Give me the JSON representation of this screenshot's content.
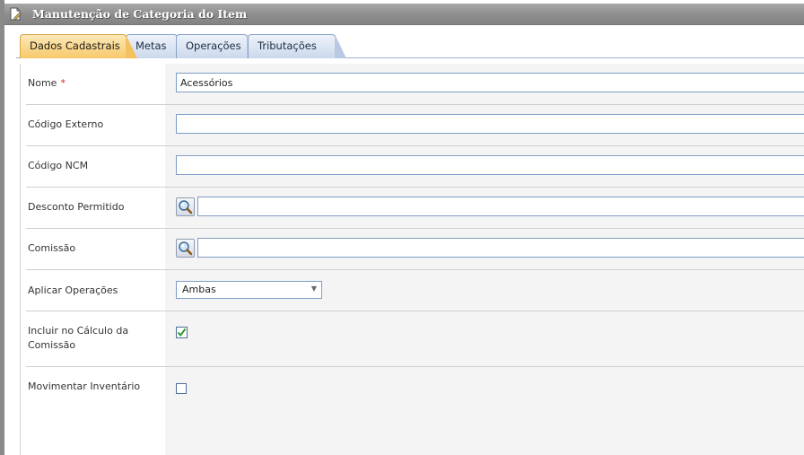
{
  "window": {
    "title": "Manutenção de Categoria do Item",
    "icon": "document-edit-icon"
  },
  "tabs": [
    {
      "label": "Dados Cadastrais",
      "active": true
    },
    {
      "label": "Metas",
      "active": false
    },
    {
      "label": "Operações",
      "active": false
    },
    {
      "label": "Tributações",
      "active": false
    }
  ],
  "form": {
    "nome": {
      "label": "Nome",
      "required_mark": "*",
      "value": "Acessórios"
    },
    "codigo_externo": {
      "label": "Código Externo",
      "value": ""
    },
    "codigo_ncm": {
      "label": "Código NCM",
      "value": ""
    },
    "desconto_permitido": {
      "label": "Desconto Permitido",
      "value": "",
      "lookup_icon": "magnifier-icon"
    },
    "comissao": {
      "label": "Comissão",
      "value": "",
      "lookup_icon": "magnifier-icon"
    },
    "aplicar_operacoes": {
      "label": "Aplicar Operações",
      "selected": "Ambas"
    },
    "incluir_calculo": {
      "label": "Incluir no Cálculo da Comissão",
      "checked": true
    },
    "movimentar_inventario": {
      "label": "Movimentar Inventário",
      "checked": false
    }
  },
  "colors": {
    "required": "#e02020",
    "active_tab": "#f7c96b",
    "inactive_tab": "#cbd8ec",
    "input_border": "#7f9dc6",
    "check": "#2e9a2e"
  }
}
